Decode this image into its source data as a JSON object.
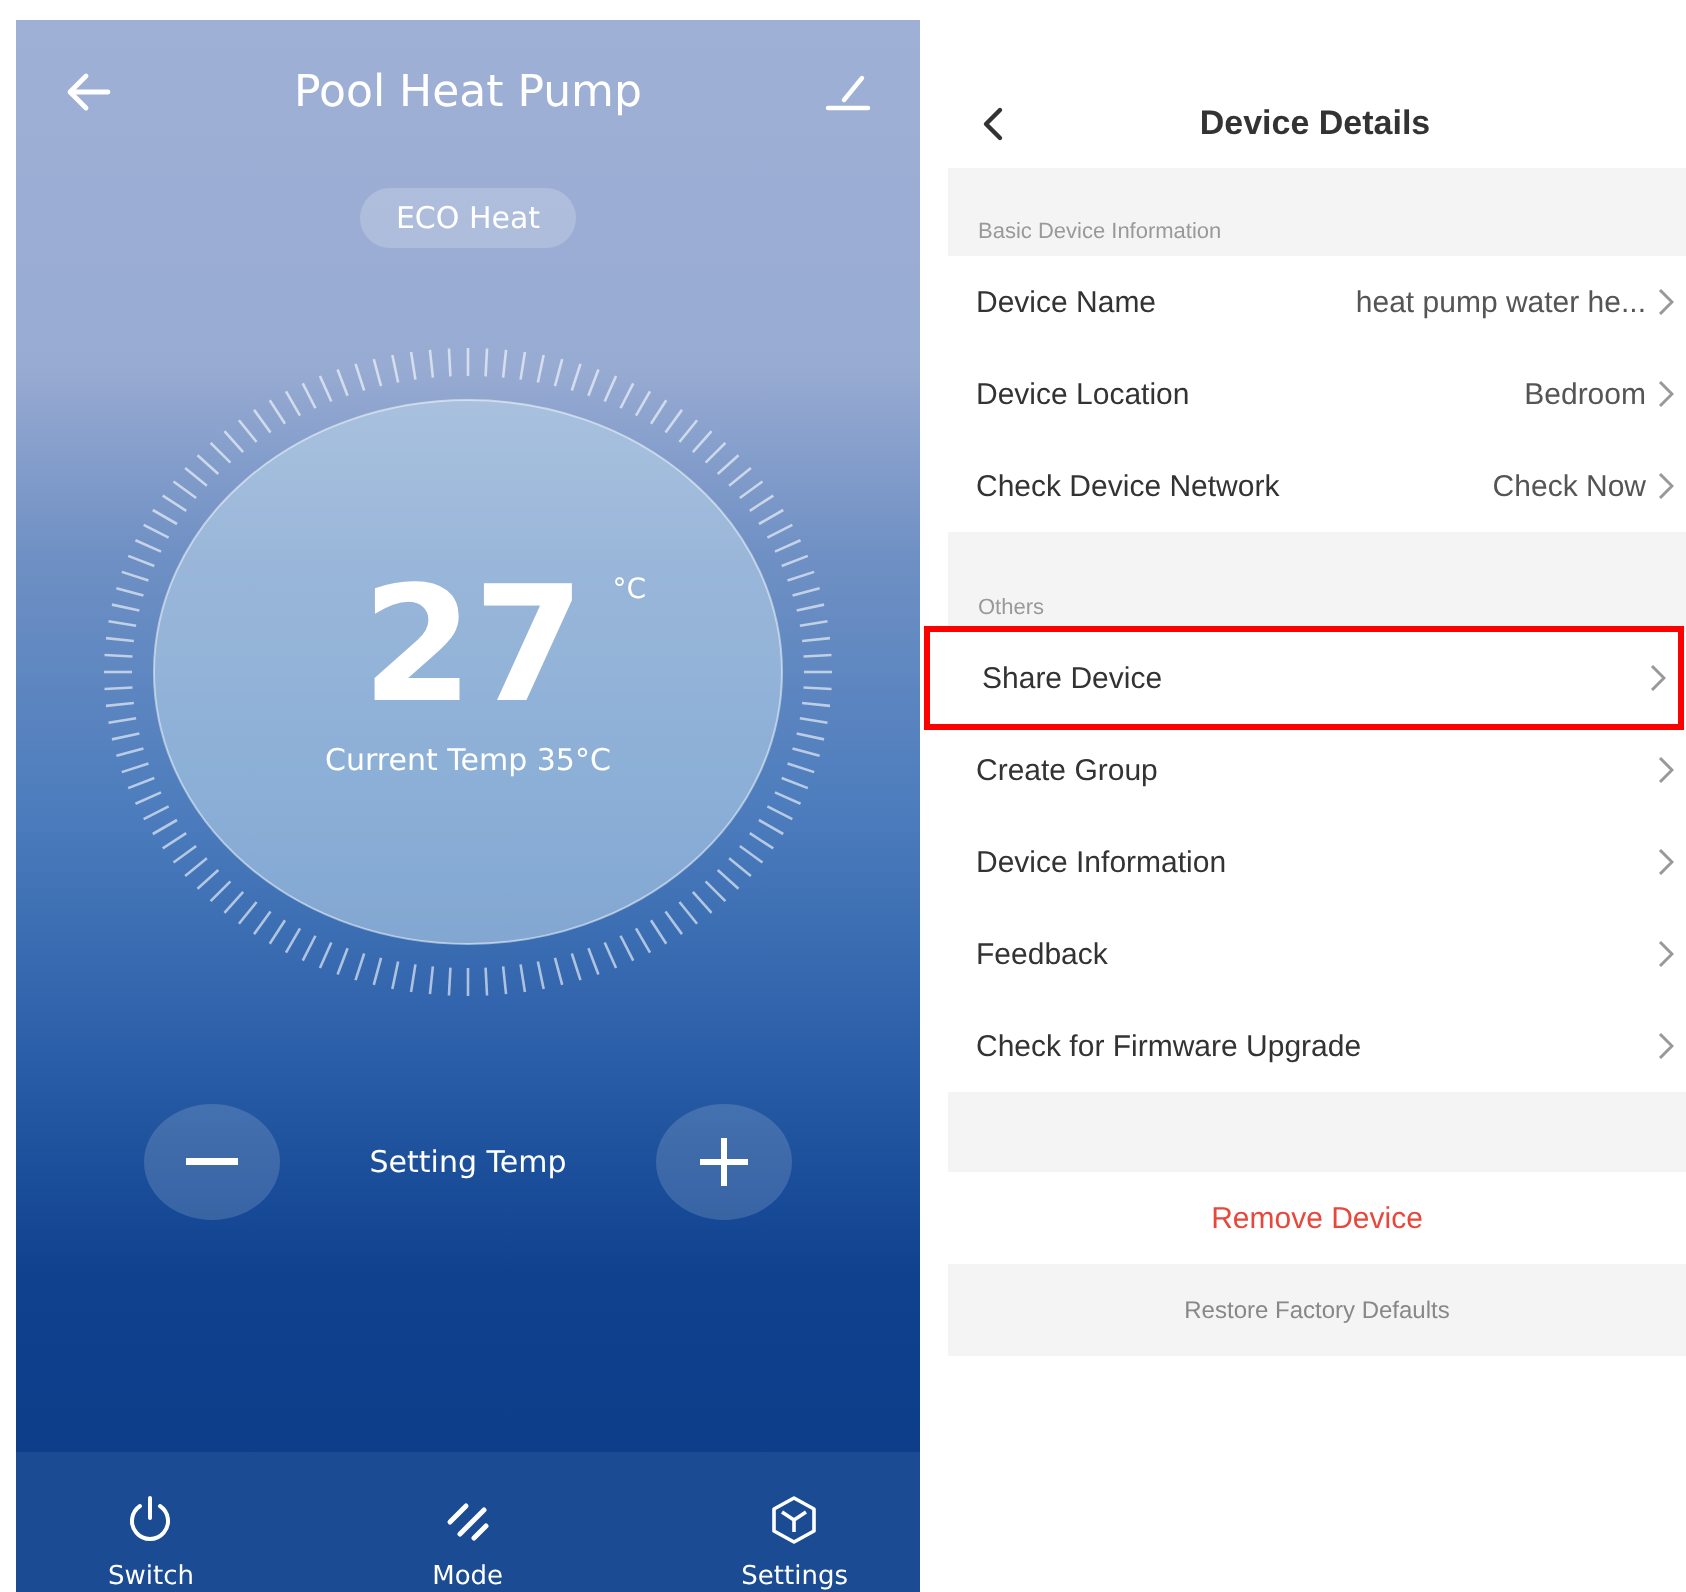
{
  "heat_pump": {
    "title": "Pool Heat Pump",
    "mode_badge": "ECO Heat",
    "set_temp": "27",
    "unit": "°C",
    "current_temp": "Current Temp 35°C",
    "setting_label": "Setting Temp",
    "nav": [
      {
        "kind": "power",
        "label": "Switch"
      },
      {
        "kind": "mode",
        "label": "Mode"
      },
      {
        "kind": "settings",
        "label": "Settings"
      }
    ]
  },
  "device_details": {
    "title": "Device Details",
    "sections": [
      {
        "heading": "Basic Device Information",
        "rows": [
          {
            "label": "Device Name",
            "value": "heat pump water he...",
            "highlighted": false
          },
          {
            "label": "Device Location",
            "value": "Bedroom",
            "highlighted": false
          },
          {
            "label": "Check Device Network",
            "value": "Check Now",
            "highlighted": false
          }
        ]
      },
      {
        "heading": "Others",
        "rows": [
          {
            "label": "Share Device",
            "highlighted": true
          },
          {
            "label": "Create Group",
            "highlighted": false
          },
          {
            "label": "Device Information",
            "highlighted": false
          },
          {
            "label": "Feedback",
            "highlighted": false
          },
          {
            "label": "Check for Firmware Upgrade",
            "highlighted": false
          }
        ]
      }
    ],
    "remove_button": "Remove Device",
    "restore_link": "Restore Factory Defaults"
  }
}
